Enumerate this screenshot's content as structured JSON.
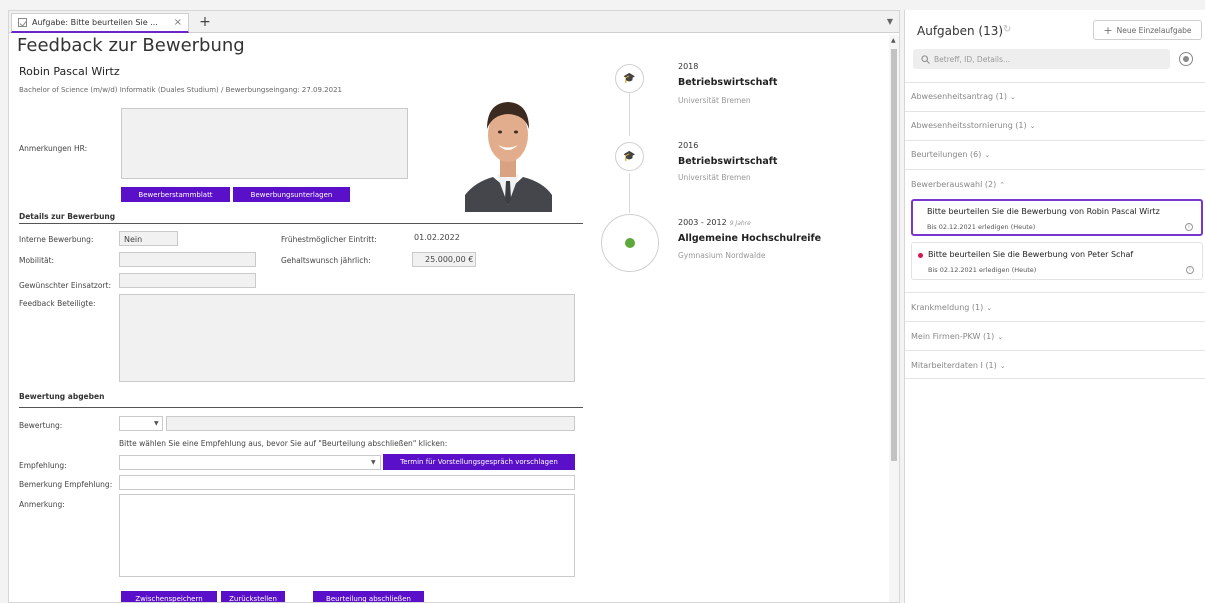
{
  "tab": {
    "label": "Aufgabe: Bitte beurteilen Sie ...",
    "close": "×",
    "add": "+"
  },
  "form": {
    "title": "Feedback zur Bewerbung",
    "candidate_name": "Robin Pascal Wirtz",
    "candidate_sub": "Bachelor of Science (m/w/d) Informatik (Duales Studium) / Bewerbungseingang: 27.09.2021",
    "hr_notes_label": "Anmerkungen HR:",
    "btn_stammblatt": "Bewerberstammblatt",
    "btn_unterlagen": "Bewerbungsunterlagen",
    "details": {
      "heading": "Details zur Bewerbung",
      "internal_label": "Interne Bewerbung:",
      "internal_value": "Nein",
      "mobility_label": "Mobilität:",
      "location_label": "Gewünschter Einsatzort:",
      "feedback_label": "Feedback Beteiligte:",
      "start_label": "Frühestmöglicher Eintritt:",
      "start_value": "01.02.2022",
      "salary_label": "Gehaltswunsch jährlich:",
      "salary_value": "25.000,00 €"
    },
    "rating": {
      "heading": "Bewertung abgeben",
      "rating_label": "Bewertung:",
      "hint": "Bitte wählen Sie eine Empfehlung aus, bevor Sie auf \"Beurteilung abschließen\" klicken:",
      "recommendation_label": "Empfehlung:",
      "btn_termin": "Termin für Vorstellungsgespräch vorschlagen",
      "rec_note_label": "Bemerkung Empfehlung:",
      "note_label": "Anmerkung:"
    },
    "btn_save": "Zwischenspeichern",
    "btn_defer": "Zurückstellen",
    "btn_finish": "Beurteilung abschließen"
  },
  "timeline": [
    {
      "year": "2018",
      "years_note": "",
      "degree": "Betriebswirtschaft",
      "school": "Universität Bremen",
      "icon": "graduation-cap-icon"
    },
    {
      "year": "2016",
      "years_note": "",
      "degree": "Betriebswirtschaft",
      "school": "Universität Bremen",
      "icon": "graduation-cap-icon"
    },
    {
      "year": "2003 - 2012",
      "years_note": "9 Jahre",
      "degree": "Allgemeine Hochschulreife",
      "school": "Gymnasium Nordwalde",
      "icon": "apple-icon"
    }
  ],
  "tasks_panel": {
    "title": "Aufgaben (13)",
    "new_task": "Neue Einzelaufgabe",
    "search_placeholder": "Betreff, ID, Details...",
    "groups": [
      {
        "label": "Abwesenheitsantrag (1)"
      },
      {
        "label": "Abwesenheitsstornierung (1)"
      },
      {
        "label": "Beurteilungen (6)"
      },
      {
        "label": "Bewerberauswahl (2)"
      },
      {
        "label": "Krankmeldung (1)"
      },
      {
        "label": "Mein Firmen-PKW (1)"
      },
      {
        "label": "Mitarbeiterdaten I (1)"
      }
    ],
    "tasks": [
      {
        "title": "Bitte beurteilen Sie die Bewerbung von Robin Pascal Wirtz",
        "due": "Bis 02.12.2021 erledigen (Heute)"
      },
      {
        "title": "Bitte beurteilen Sie die Bewerbung von Peter Schaf",
        "due": "Bis 02.12.2021 erledigen (Heute)"
      }
    ]
  },
  "colors": {
    "accent": "#5a0fc8",
    "active_border": "#7636cf",
    "alert_dot": "#d9134e"
  }
}
